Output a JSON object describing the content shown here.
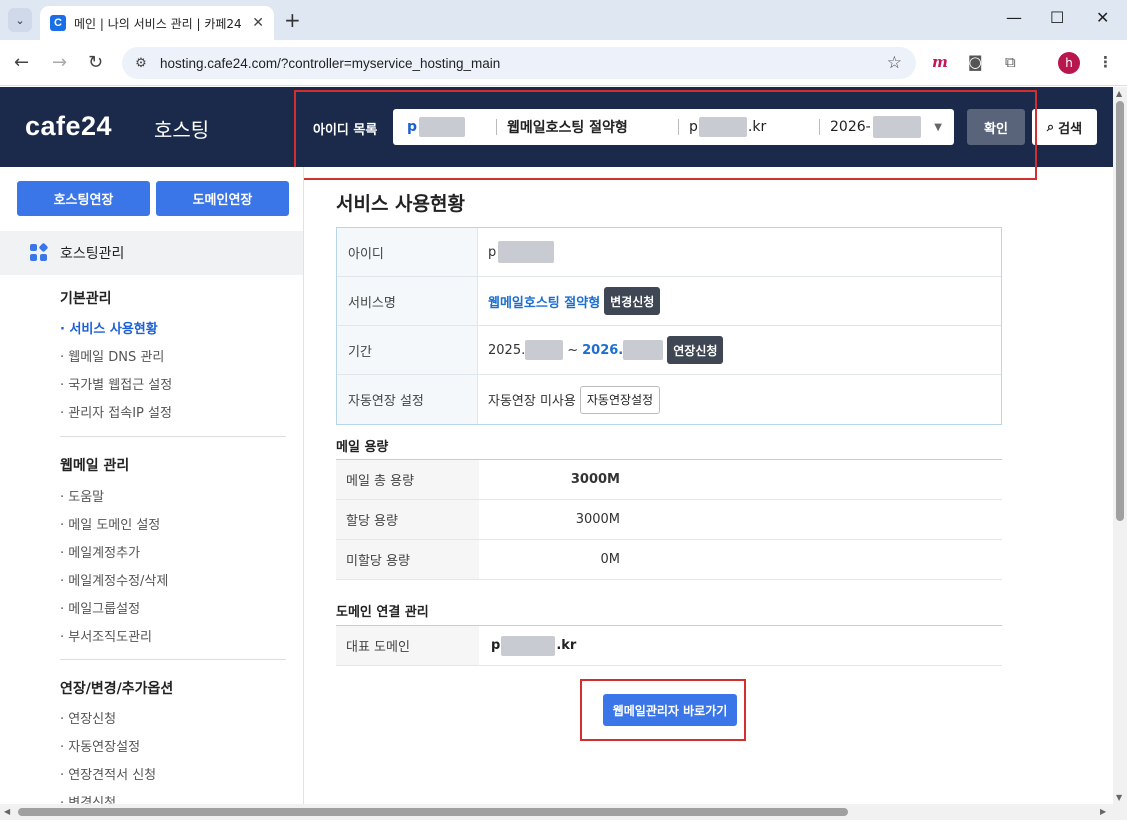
{
  "browser": {
    "tab_title": "메인 | 나의 서비스 관리 | 카페24",
    "tab_favicon": "C",
    "url": "hosting.cafe24.com/?controller=myservice_hosting_main",
    "profile_initial": "h"
  },
  "header": {
    "logo": "cafe24",
    "logo_sub": "호스팅",
    "id_label": "아이디 목록",
    "select": {
      "user_id": "p",
      "service": "웹메일호스팅 절약형",
      "domain_prefix": "p",
      "domain_suffix": ".kr",
      "expiry": "2026-"
    },
    "confirm_label": "확인",
    "search_label": "검색"
  },
  "sidebar": {
    "btn_hosting_extend": "호스팅연장",
    "btn_domain_extend": "도메인연장",
    "hosting_mgmt": "호스팅관리",
    "groups": [
      {
        "title": "기본관리",
        "items": [
          "서비스 사용현황",
          "웹메일 DNS 관리",
          "국가별 웹접근 설정",
          "관리자 접속IP 설정"
        ]
      },
      {
        "title": "웹메일 관리",
        "items": [
          "도움말",
          "메일 도메인 설정",
          "메일계정추가",
          "메일계정수정/삭제",
          "메일그룹설정",
          "부서조직도관리"
        ]
      },
      {
        "title": "연장/변경/추가옵션",
        "items": [
          "연장신청",
          "자동연장설정",
          "연장견적서 신청",
          "변경신청"
        ]
      }
    ]
  },
  "main": {
    "title": "서비스 사용현황",
    "info": {
      "id_label": "아이디",
      "id_value": "p",
      "service_label": "서비스명",
      "service_value": "웹메일호스팅 절약형",
      "change_btn": "변경신청",
      "period_label": "기간",
      "period_start": "2025.",
      "period_sep": "~",
      "period_end": "2026.",
      "extend_btn": "연장신청",
      "auto_label": "자동연장 설정",
      "auto_value": "자동연장 미사용",
      "auto_btn": "자동연장설정"
    },
    "mail": {
      "title": "메일 용량",
      "rows": [
        {
          "label": "메일 총 용량",
          "value": "3000M"
        },
        {
          "label": "할당 용량",
          "value": "3000M"
        },
        {
          "label": "미할당 용량",
          "value": "0M"
        }
      ]
    },
    "domain": {
      "title": "도메인 연결 관리",
      "label": "대표 도메인",
      "prefix": "p",
      "suffix": ".kr"
    },
    "webmail_btn": "웹메일관리자 바로가기"
  }
}
